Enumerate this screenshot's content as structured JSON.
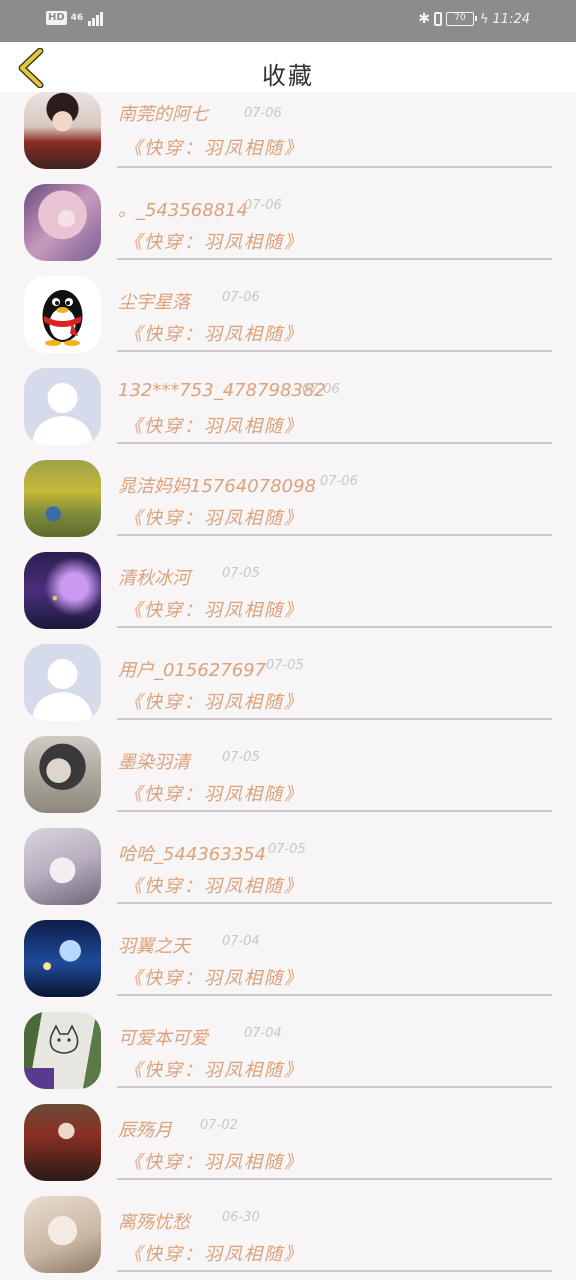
{
  "status_bar": {
    "left_badge": "HD",
    "network": "46",
    "battery": "70",
    "time": "11:24"
  },
  "header": {
    "title": "收藏"
  },
  "favorites": [
    {
      "user": "南莞的阿七",
      "date": "07-06",
      "book": "《快穿：羽凤相随》",
      "avatar": "girl-portrait"
    },
    {
      "user": "。_543568814",
      "date": "07-06",
      "book": "《快穿：羽凤相随》",
      "avatar": "pink-girl-portrait"
    },
    {
      "user": "尘宇星落",
      "date": "07-06",
      "book": "《快穿：羽凤相随》",
      "avatar": "qq-penguin"
    },
    {
      "user": "132***753_478798382",
      "date": "07-06",
      "book": "《快穿：羽凤相随》",
      "avatar": "default-person"
    },
    {
      "user": "晁洁妈妈15764078098",
      "date": "07-06",
      "book": "《快穿：羽凤相随》",
      "avatar": "child-in-field"
    },
    {
      "user": "清秋冰河",
      "date": "07-05",
      "book": "《快穿：羽凤相随》",
      "avatar": "night-tree"
    },
    {
      "user": "用户_015627697",
      "date": "07-05",
      "book": "《快穿：羽凤相随》",
      "avatar": "default-person"
    },
    {
      "user": "墨染羽清",
      "date": "07-05",
      "book": "《快穿：羽凤相随》",
      "avatar": "ink-portrait"
    },
    {
      "user": "哈哈_544363354",
      "date": "07-05",
      "book": "《快穿：羽凤相随》",
      "avatar": "white-hair-boy"
    },
    {
      "user": "羽翼之天",
      "date": "07-04",
      "book": "《快穿：羽凤相随》",
      "avatar": "blue-anime-girl"
    },
    {
      "user": "可爱本可爱",
      "date": "07-04",
      "book": "《快穿：羽凤相随》",
      "avatar": "cat-drawing"
    },
    {
      "user": "辰殇月",
      "date": "07-02",
      "book": "《快穿：羽凤相随》",
      "avatar": "warrior-portrait"
    },
    {
      "user": "离殇忧愁",
      "date": "06-30",
      "book": "《快穿：羽凤相随》",
      "avatar": "white-fox-portrait"
    }
  ]
}
